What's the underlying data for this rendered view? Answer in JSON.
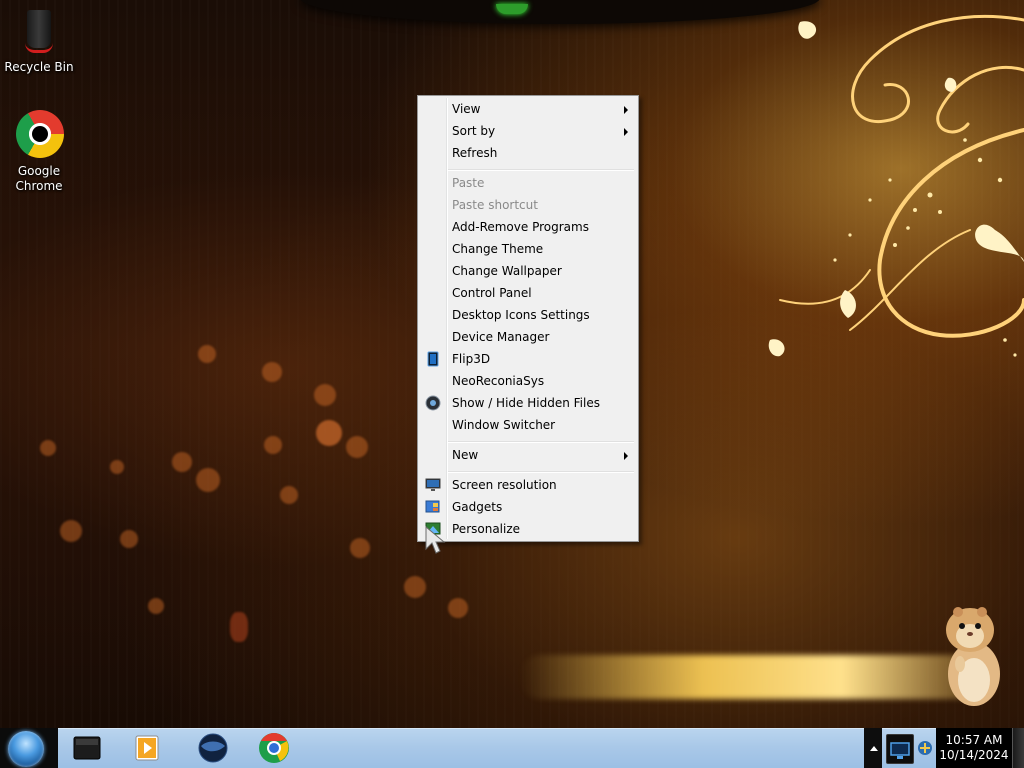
{
  "desktop": {
    "icons": [
      {
        "label": "Recycle Bin",
        "icon": "recycle-bin-icon"
      },
      {
        "label": "Google\nChrome",
        "icon": "chrome-icon"
      }
    ]
  },
  "context_menu": {
    "items": [
      {
        "label": "View",
        "submenu": true,
        "enabled": true
      },
      {
        "label": "Sort by",
        "submenu": true,
        "enabled": true
      },
      {
        "label": "Refresh",
        "submenu": false,
        "enabled": true
      },
      {
        "label": "Paste",
        "submenu": false,
        "enabled": false
      },
      {
        "label": "Paste shortcut",
        "submenu": false,
        "enabled": false
      },
      {
        "label": "Add-Remove Programs",
        "submenu": false,
        "enabled": true
      },
      {
        "label": "Change Theme",
        "submenu": false,
        "enabled": true
      },
      {
        "label": "Change Wallpaper",
        "submenu": false,
        "enabled": true
      },
      {
        "label": "Control Panel",
        "submenu": false,
        "enabled": true
      },
      {
        "label": "Desktop Icons Settings",
        "submenu": false,
        "enabled": true
      },
      {
        "label": "Device Manager",
        "submenu": false,
        "enabled": true
      },
      {
        "label": "Flip3D",
        "submenu": false,
        "enabled": true,
        "icon": "flip3d-icon"
      },
      {
        "label": "NeoReconiaSys",
        "submenu": false,
        "enabled": true
      },
      {
        "label": "Show / Hide Hidden Files",
        "submenu": false,
        "enabled": true,
        "icon": "hidden-files-icon"
      },
      {
        "label": "Window Switcher",
        "submenu": false,
        "enabled": true
      },
      {
        "label": "New",
        "submenu": true,
        "enabled": true
      },
      {
        "label": "Screen resolution",
        "submenu": false,
        "enabled": true,
        "icon": "screen-resolution-icon"
      },
      {
        "label": "Gadgets",
        "submenu": false,
        "enabled": true,
        "icon": "gadgets-icon"
      },
      {
        "label": "Personalize",
        "submenu": false,
        "enabled": true,
        "icon": "personalize-icon"
      }
    ]
  },
  "taskbar": {
    "start_button": "start-orb-icon",
    "pinned": [
      {
        "name": "explorer",
        "icon": "file-explorer-icon"
      },
      {
        "name": "media-player",
        "icon": "media-player-icon"
      },
      {
        "name": "network",
        "icon": "globe-icon"
      },
      {
        "name": "chrome",
        "icon": "chrome-icon"
      }
    ],
    "tray": {
      "icons": [
        "monitor-icon",
        "network-tray-icon"
      ]
    },
    "clock": {
      "time": "10:57 AM",
      "date": "10/14/2024"
    }
  },
  "colors": {
    "menu_background": "#f0f0f0",
    "menu_border": "#979797",
    "disabled_text": "#8a8a8a",
    "taskbar": "#a9c8e8"
  }
}
